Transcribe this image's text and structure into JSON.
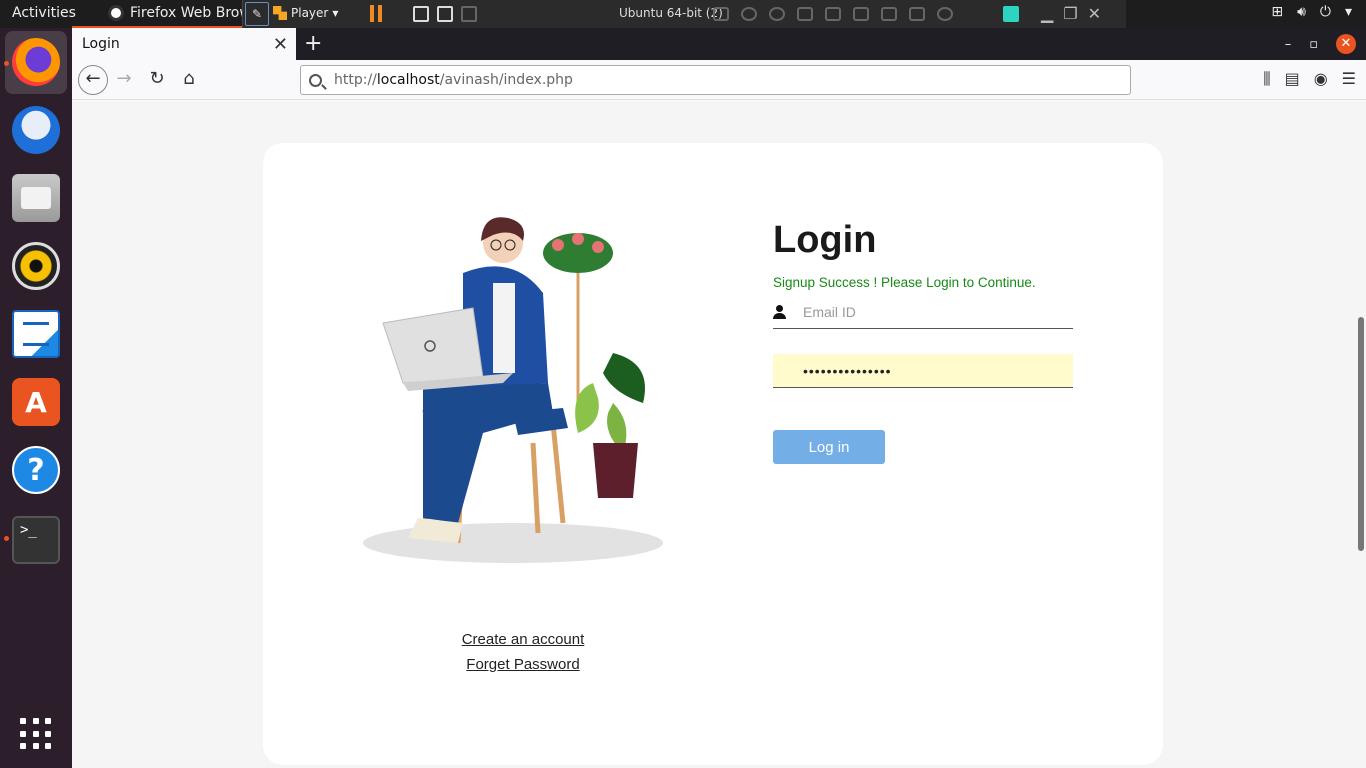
{
  "topbar": {
    "activities": "Activities",
    "app_menu": "Firefox Web Browser",
    "vm_player_label": "Player",
    "vm_title": "Ubuntu 64-bit (2)"
  },
  "browser": {
    "tab_title": "Login",
    "url_prefix": "http://",
    "url_host": "localhost",
    "url_path": "/avinash/index.php"
  },
  "login": {
    "title": "Login",
    "success_message": "Signup Success ! Please Login to Continue.",
    "email_placeholder": "Email ID",
    "email_value": "",
    "password_value": "•••••••••••••••",
    "button_label": "Log in",
    "create_account_link": "Create an account",
    "forget_password_link": "Forget Password"
  },
  "colors": {
    "accent_ubuntu": "#e95420",
    "success_text": "#178a17",
    "login_button": "#73aee6",
    "autofill_bg": "#fffbcc"
  },
  "dock": {
    "items": [
      "firefox-icon",
      "thunderbird-icon",
      "files-icon",
      "rhythmbox-icon",
      "libreoffice-writer-icon",
      "ubuntu-software-icon",
      "help-icon",
      "terminal-icon",
      "show-applications-icon"
    ]
  }
}
